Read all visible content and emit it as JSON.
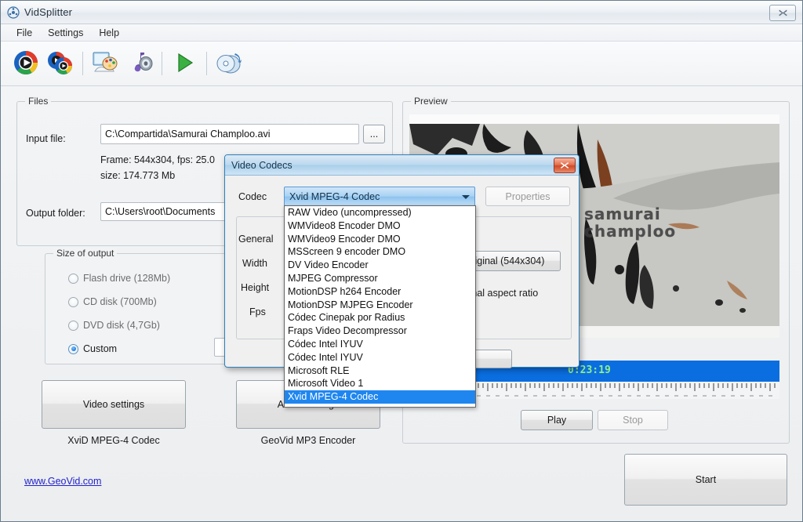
{
  "window": {
    "title": "VidSplitter",
    "app_icon": "film-reel-icon",
    "close_label": "✕"
  },
  "menu": {
    "items": [
      "File",
      "Settings",
      "Help"
    ]
  },
  "toolbar": {
    "buttons": [
      {
        "name": "open-video-icon",
        "tip": "Open video"
      },
      {
        "name": "open-multiple-videos-icon",
        "tip": "Open several videos"
      },
      {
        "name": "video-effects-icon",
        "tip": "Video settings"
      },
      {
        "name": "audio-settings-icon",
        "tip": "Audio settings"
      },
      {
        "name": "start-conversion-icon",
        "tip": "Start"
      },
      {
        "name": "burn-disc-icon",
        "tip": "Burn to disc"
      }
    ]
  },
  "files": {
    "legend": "Files",
    "input_label": "Input file:",
    "input_value": "C:\\Compartida\\Samurai Champloo.avi",
    "browse_label": "...",
    "info_line1": "Frame: 544x304, fps: 25.0",
    "info_line2": "size: 174.773 Mb",
    "output_label": "Output folder:",
    "output_value": "C:\\Users\\root\\Documents"
  },
  "size_of_output": {
    "legend": "Size of output",
    "options": [
      {
        "label": "Flash drive (128Mb)",
        "selected": false
      },
      {
        "label": "CD disk (700Mb)",
        "selected": false
      },
      {
        "label": "DVD disk (4,7Gb)",
        "selected": false
      },
      {
        "label": "Custom",
        "selected": true
      }
    ],
    "custom_value": ""
  },
  "settings_buttons": {
    "video_button": "Video settings",
    "video_caption": "XviD MPEG-4 Codec",
    "audio_button": "Audio settings",
    "audio_caption": "GeoVid MP3 Encoder"
  },
  "preview": {
    "legend": "Preview",
    "image_title_line1": "samurai",
    "image_title_line2": "champloo",
    "timecode": "0:23:19",
    "play_label": "Play",
    "stop_label": "Stop"
  },
  "footer": {
    "link": "www.GeoVid.com",
    "start_label": "Start"
  },
  "dialog": {
    "title": "Video Codecs",
    "close_label": "✕",
    "codec_label": "Codec",
    "codec_value": "Xvid MPEG-4 Codec",
    "properties_label": "Properties",
    "fields": [
      "General",
      "Width",
      "Height",
      "Fps"
    ],
    "original_button": "Original (544x304)",
    "aspect_text": "Original aspect ratio",
    "codec_options": [
      "RAW Video (uncompressed)",
      "WMVideo8 Encoder DMO",
      "WMVideo9 Encoder DMO",
      "MSScreen 9 encoder DMO",
      "DV Video Encoder",
      "MJPEG Compressor",
      "MotionDSP h264 Encoder",
      "MotionDSP MJPEG Encoder",
      "Códec Cinepak por Radius",
      "Fraps Video Decompressor",
      "Códec Intel IYUV",
      "Códec Intel IYUV",
      "Microsoft RLE",
      "Microsoft Video 1",
      "Xvid MPEG-4 Codec"
    ],
    "selected_option_index": 14
  },
  "colors": {
    "accent": "#1f86f0",
    "timeline": "#0a6ee0",
    "timecode": "#8ef08e",
    "link": "#2323c8",
    "dialog_border": "#2f7fb5"
  }
}
